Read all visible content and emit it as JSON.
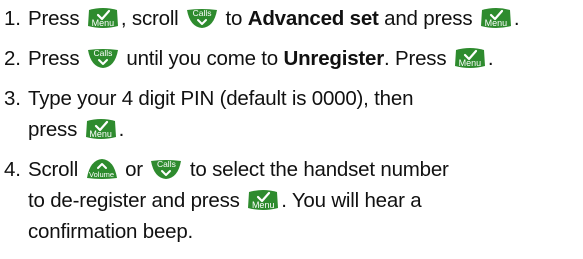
{
  "keys": {
    "menu_label": "Menu",
    "calls_label": "Calls",
    "volume_label": "Volume",
    "key_color": "#2e8b2e"
  },
  "steps": [
    {
      "num": "1.",
      "t1": "Press",
      "t2": ", scroll",
      "t3": "to",
      "bold": "Advanced set",
      "t4": "and press",
      "t5": "."
    },
    {
      "num": "2.",
      "t1": "Press",
      "t2": "until you come to",
      "bold": "Unregister",
      "t3": ". Press",
      "t4": "."
    },
    {
      "num": "3.",
      "line1": "Type your 4 digit PIN (default is 0000), then",
      "line2_pre": "press",
      "line2_post": "."
    },
    {
      "num": "4.",
      "t1": "Scroll",
      "t2": "or",
      "t3": "to select the handset number",
      "line2_pre": "to de-register and press",
      "line2_post": ". You will hear a",
      "line3": "confirmation beep."
    }
  ]
}
